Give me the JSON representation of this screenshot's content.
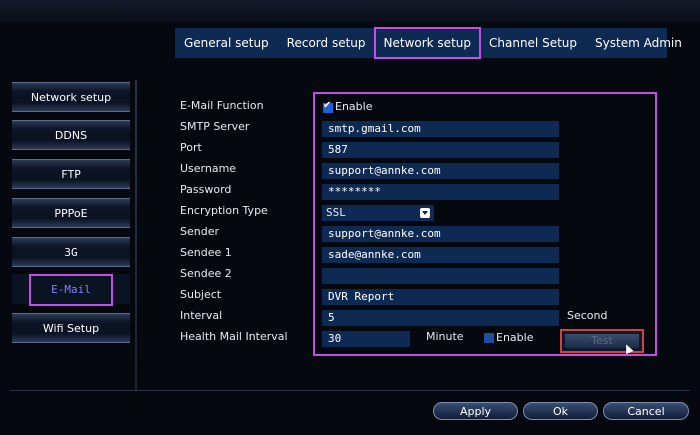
{
  "tabs": [
    {
      "label": "General setup"
    },
    {
      "label": "Record setup"
    },
    {
      "label": "Network setup"
    },
    {
      "label": "Channel Setup"
    },
    {
      "label": "System Admin"
    }
  ],
  "sidebar": {
    "items": [
      {
        "label": "Network setup"
      },
      {
        "label": "DDNS"
      },
      {
        "label": "FTP"
      },
      {
        "label": "PPPoE"
      },
      {
        "label": "3G"
      },
      {
        "label": "E-Mail"
      },
      {
        "label": "Wifi Setup"
      }
    ]
  },
  "email": {
    "function_label": "E-Mail Function",
    "function_enable_text": "Enable",
    "function_enabled": true,
    "smtp_label": "SMTP Server",
    "smtp_value": "smtp.gmail.com",
    "port_label": "Port",
    "port_value": "587",
    "username_label": "Username",
    "username_value": "support@annke.com",
    "password_label": "Password",
    "password_value": "********",
    "encryption_label": "Encryption Type",
    "encryption_value": "SSL",
    "sender_label": "Sender",
    "sender_value": "support@annke.com",
    "sendee1_label": "Sendee 1",
    "sendee1_value": "sade@annke.com",
    "sendee2_label": "Sendee 2",
    "sendee2_value": "",
    "subject_label": "Subject",
    "subject_value": "DVR Report",
    "interval_label": "Interval",
    "interval_value": "5",
    "interval_unit": "Second",
    "health_label": "Health Mail Interval",
    "health_value": "30",
    "health_unit": "Minute",
    "health_enable_text": "Enable",
    "health_enabled": false,
    "test_label": "Test"
  },
  "actions": {
    "apply": "Apply",
    "ok": "Ok",
    "cancel": "Cancel"
  },
  "colors": {
    "accent_highlight": "#c34fe6",
    "field_bg": "#0f2a52",
    "test_outline": "#d0443c"
  }
}
